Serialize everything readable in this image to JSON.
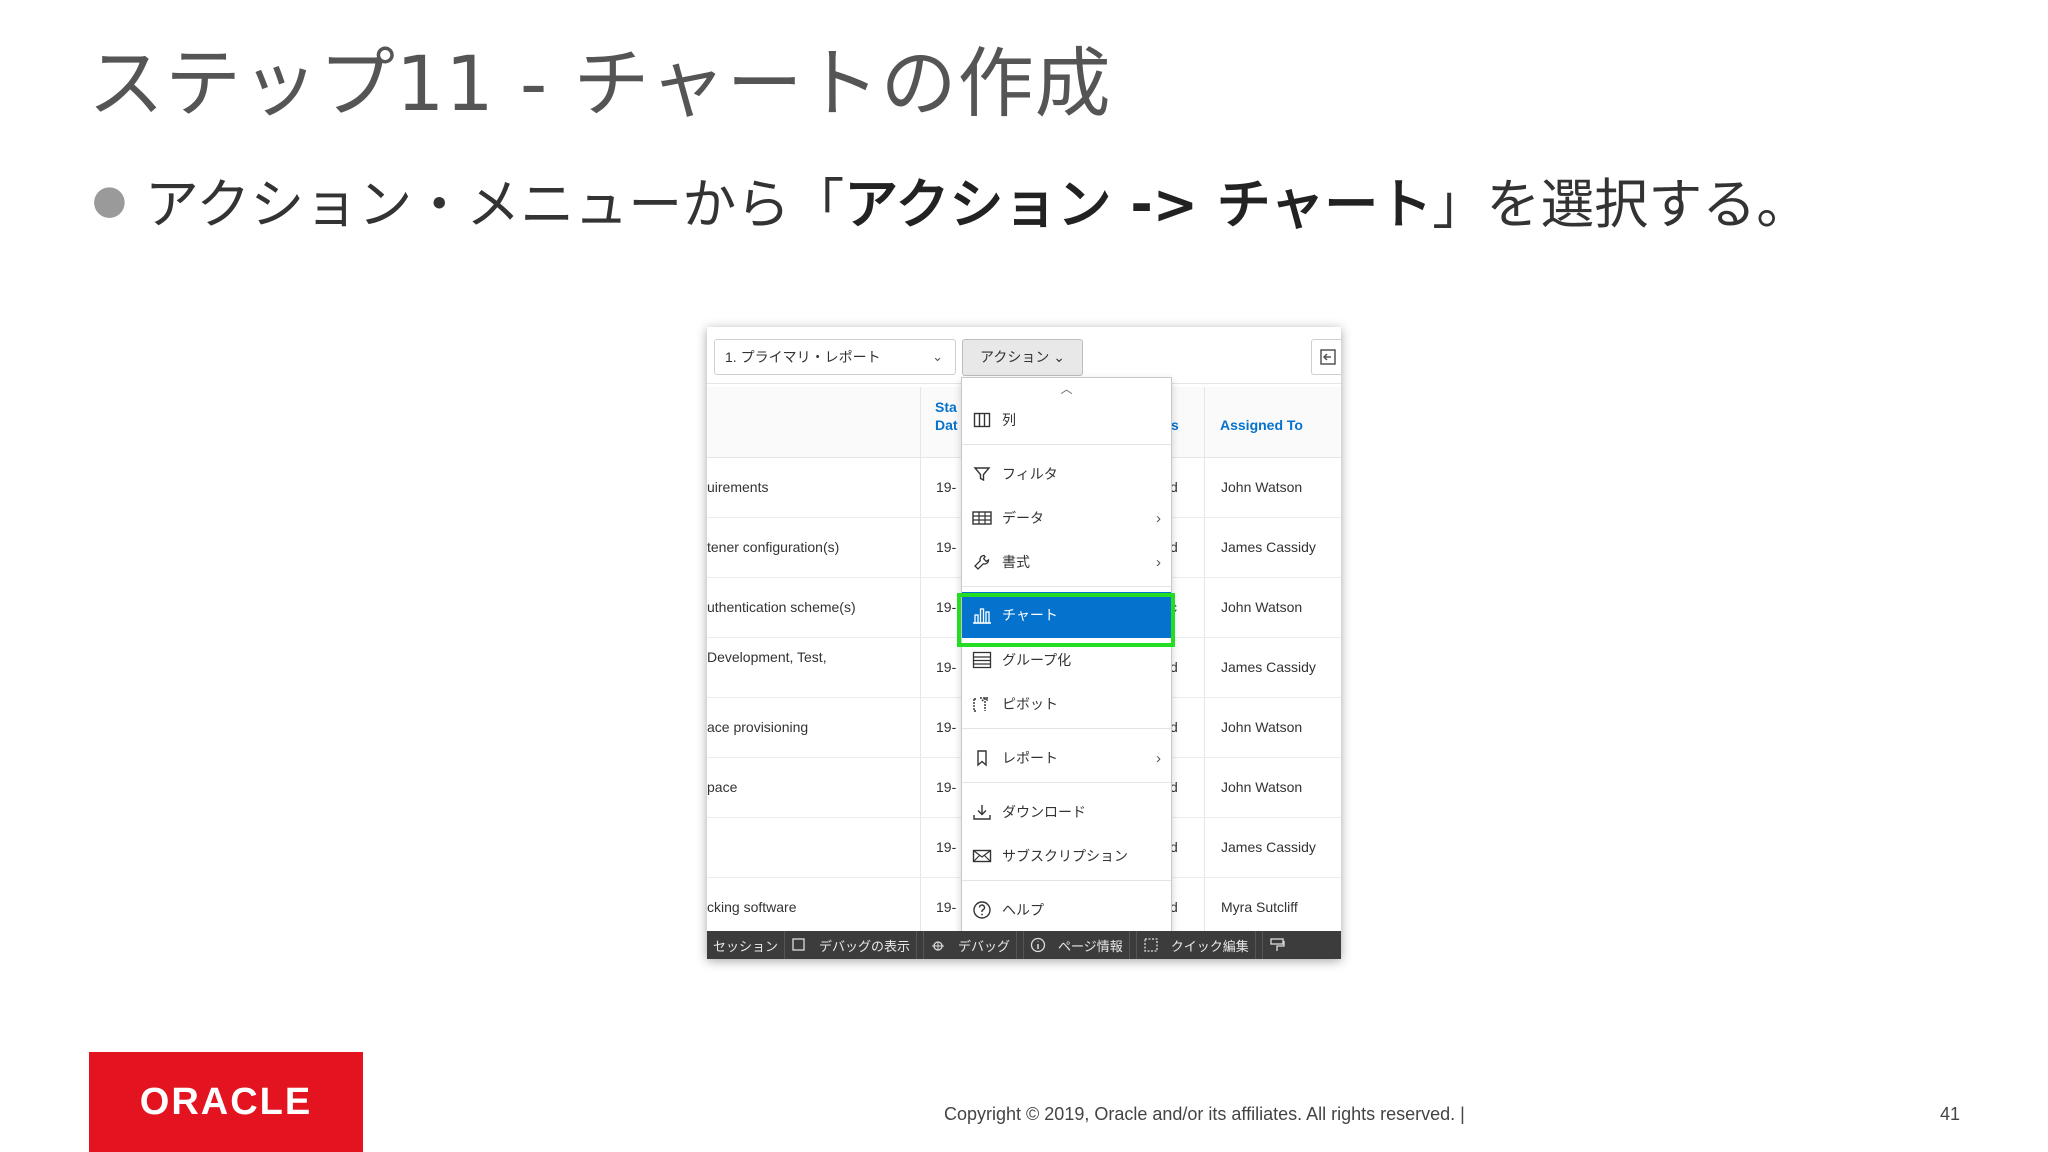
{
  "slide": {
    "title": "ステップ11 - チャートの作成",
    "bullet_pre": "アクション・メニューから「",
    "bullet_bold": "アクション -> チャート",
    "bullet_post": "」を選択する。"
  },
  "toolbar": {
    "report_select_value": "1. プライマリ・レポート",
    "actions_label": "アクション"
  },
  "table": {
    "headers": {
      "start_date_1": "Sta",
      "start_date_2": "Dat",
      "status": "s",
      "assigned_to": "Assigned To"
    },
    "rows": [
      {
        "task": "uirements",
        "date": "19-",
        "status": "d",
        "assigned": "John Watson"
      },
      {
        "task": "tener configuration(s)",
        "date": "19-",
        "status": "d",
        "assigned": "James Cassidy"
      },
      {
        "task": "uthentication scheme(s)",
        "date": "19-",
        "status": "c",
        "assigned": "John Watson"
      },
      {
        "task": "Development, Test,",
        "date": "19-",
        "status": "d",
        "assigned": "James Cassidy"
      },
      {
        "task": "ace provisioning",
        "date": "19-",
        "status": "d",
        "assigned": "John Watson"
      },
      {
        "task": "pace",
        "date": "19-",
        "status": "d",
        "assigned": "John Watson"
      },
      {
        "task": "",
        "date": "19-",
        "status": "d",
        "assigned": "James Cassidy"
      },
      {
        "task": "cking software",
        "date": "19-",
        "status": "d",
        "assigned": "Myra Sutcliff"
      }
    ]
  },
  "menu": {
    "items": [
      {
        "label": "列",
        "icon": "columns-icon",
        "submenu": false
      },
      {
        "label": "フィルタ",
        "icon": "filter-icon",
        "submenu": false
      },
      {
        "label": "データ",
        "icon": "table-icon",
        "submenu": true
      },
      {
        "label": "書式",
        "icon": "wrench-icon",
        "submenu": true
      },
      {
        "label": "チャート",
        "icon": "bar-chart-icon",
        "submenu": false,
        "active": true
      },
      {
        "label": "グループ化",
        "icon": "group-icon",
        "submenu": false
      },
      {
        "label": "ピボット",
        "icon": "pivot-icon",
        "submenu": false
      },
      {
        "label": "レポート",
        "icon": "bookmark-icon",
        "submenu": true
      },
      {
        "label": "ダウンロード",
        "icon": "download-icon",
        "submenu": false
      },
      {
        "label": "サブスクリプション",
        "icon": "mail-icon",
        "submenu": false
      },
      {
        "label": "ヘルプ",
        "icon": "help-icon",
        "submenu": false
      }
    ],
    "highlight_color": "#22dd22",
    "active_color": "#0572ce"
  },
  "devbar": {
    "items": [
      "セッション",
      "デバッグの表示",
      "デバッグ",
      "ページ情報",
      "クイック編集"
    ]
  },
  "footer": {
    "logo_text": "ORACLE",
    "copyright": "Copyright © 2019, Oracle and/or its affiliates. All rights reserved.  |",
    "page_number": "41"
  }
}
